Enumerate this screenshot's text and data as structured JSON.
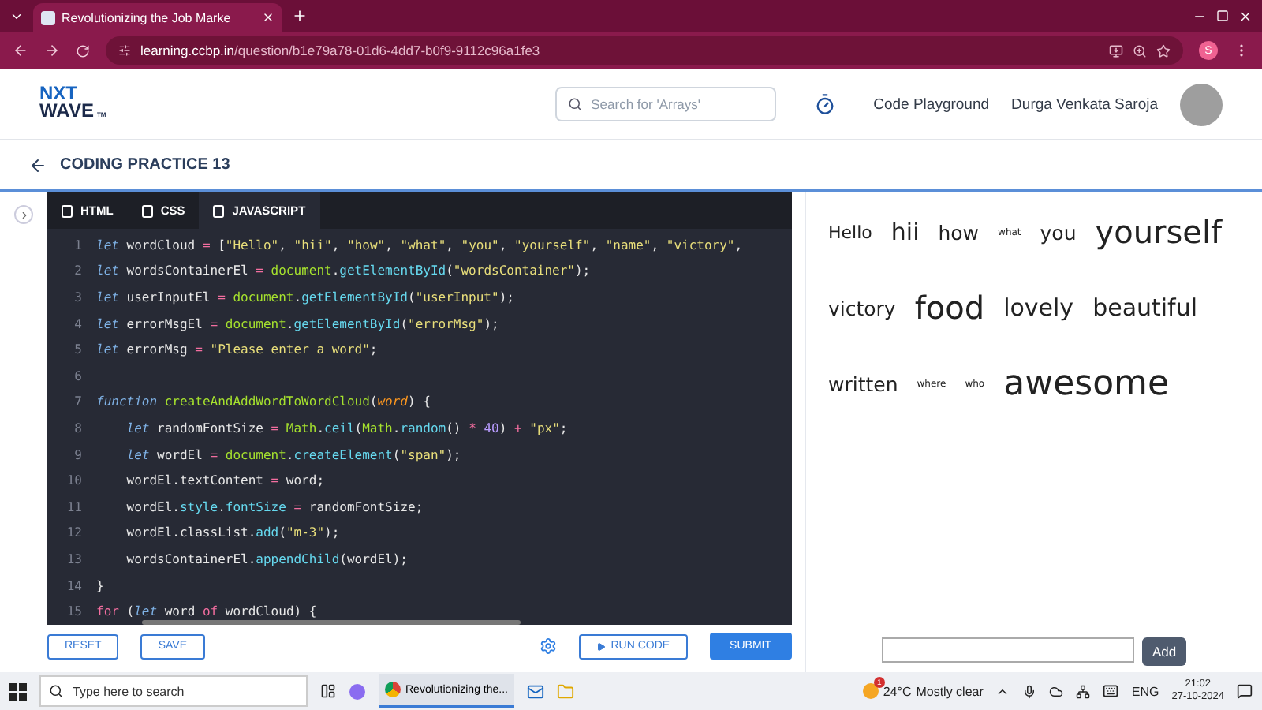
{
  "browser": {
    "tab_title": "Revolutionizing the Job Marke",
    "url_host": "learning.ccbp.in",
    "url_path": "/question/b1e79a78-01d6-4dd7-b0f9-9112c96a1fe3",
    "profile_initial": "S"
  },
  "header": {
    "logo_top": "NXT",
    "logo_bottom": "WAVE",
    "logo_mark": "TM",
    "search": {
      "placeholder": "Search for 'Arrays'"
    },
    "link": "Code Playground",
    "user_name": "Durga Venkata Saroja"
  },
  "page_title": "CODING PRACTICE 13",
  "editor_tabs": [
    {
      "label": "HTML",
      "selected": false
    },
    {
      "label": "CSS",
      "selected": false
    },
    {
      "label": "JAVASCRIPT",
      "selected": true
    }
  ],
  "code_lines": [
    {
      "number": "1",
      "tokens": [
        {
          "kind": "kw",
          "text": "let"
        },
        {
          "kind": "plain",
          "text": " wordCloud"
        },
        {
          "kind": "op",
          "text": " = "
        },
        {
          "kind": "plain",
          "text": "["
        },
        {
          "kind": "str",
          "text": "\"Hello\""
        },
        {
          "kind": "plain",
          "text": ", "
        },
        {
          "kind": "str",
          "text": "\"hii\""
        },
        {
          "kind": "plain",
          "text": ", "
        },
        {
          "kind": "str",
          "text": "\"how\""
        },
        {
          "kind": "plain",
          "text": ", "
        },
        {
          "kind": "str",
          "text": "\"what\""
        },
        {
          "kind": "plain",
          "text": ", "
        },
        {
          "kind": "str",
          "text": "\"you\""
        },
        {
          "kind": "plain",
          "text": ", "
        },
        {
          "kind": "str",
          "text": "\"yourself\""
        },
        {
          "kind": "plain",
          "text": ", "
        },
        {
          "kind": "str",
          "text": "\"name\""
        },
        {
          "kind": "plain",
          "text": ", "
        },
        {
          "kind": "str",
          "text": "\"victory\""
        },
        {
          "kind": "plain",
          "text": ","
        }
      ]
    },
    {
      "number": "2",
      "tokens": [
        {
          "kind": "kw",
          "text": "let"
        },
        {
          "kind": "plain",
          "text": " wordsContainerEl"
        },
        {
          "kind": "op",
          "text": " = "
        },
        {
          "kind": "obj",
          "text": "document"
        },
        {
          "kind": "plain",
          "text": "."
        },
        {
          "kind": "fn",
          "text": "getElementById"
        },
        {
          "kind": "plain",
          "text": "("
        },
        {
          "kind": "str",
          "text": "\"wordsContainer\""
        },
        {
          "kind": "plain",
          "text": ");"
        }
      ]
    },
    {
      "number": "3",
      "tokens": [
        {
          "kind": "kw",
          "text": "let"
        },
        {
          "kind": "plain",
          "text": " userInputEl"
        },
        {
          "kind": "op",
          "text": " = "
        },
        {
          "kind": "obj",
          "text": "document"
        },
        {
          "kind": "plain",
          "text": "."
        },
        {
          "kind": "fn",
          "text": "getElementById"
        },
        {
          "kind": "plain",
          "text": "("
        },
        {
          "kind": "str",
          "text": "\"userInput\""
        },
        {
          "kind": "plain",
          "text": ");"
        }
      ]
    },
    {
      "number": "4",
      "tokens": [
        {
          "kind": "kw",
          "text": "let"
        },
        {
          "kind": "plain",
          "text": " errorMsgEl"
        },
        {
          "kind": "op",
          "text": " = "
        },
        {
          "kind": "obj",
          "text": "document"
        },
        {
          "kind": "plain",
          "text": "."
        },
        {
          "kind": "fn",
          "text": "getElementById"
        },
        {
          "kind": "plain",
          "text": "("
        },
        {
          "kind": "str",
          "text": "\"errorMsg\""
        },
        {
          "kind": "plain",
          "text": ");"
        }
      ]
    },
    {
      "number": "5",
      "tokens": [
        {
          "kind": "kw",
          "text": "let"
        },
        {
          "kind": "plain",
          "text": " errorMsg"
        },
        {
          "kind": "op",
          "text": " = "
        },
        {
          "kind": "str",
          "text": "\"Please enter a word\""
        },
        {
          "kind": "plain",
          "text": ";"
        }
      ]
    },
    {
      "number": "6"
    },
    {
      "number": "7",
      "tokens": [
        {
          "kind": "kw",
          "text": "function "
        },
        {
          "kind": "obj",
          "text": "createAndAddWordToWordCloud"
        },
        {
          "kind": "plain",
          "text": "("
        },
        {
          "kind": "param",
          "text": "word"
        },
        {
          "kind": "plain",
          "text": ") {"
        }
      ]
    },
    {
      "number": "8",
      "tokens": [
        {
          "kind": "kw",
          "text": "    let"
        },
        {
          "kind": "plain",
          "text": " randomFontSize"
        },
        {
          "kind": "op",
          "text": " = "
        },
        {
          "kind": "obj",
          "text": "Math"
        },
        {
          "kind": "plain",
          "text": "."
        },
        {
          "kind": "fn",
          "text": "ceil"
        },
        {
          "kind": "plain",
          "text": "("
        },
        {
          "kind": "obj",
          "text": "Math"
        },
        {
          "kind": "plain",
          "text": "."
        },
        {
          "kind": "fn",
          "text": "random"
        },
        {
          "kind": "plain",
          "text": "()"
        },
        {
          "kind": "op",
          "text": " * "
        },
        {
          "kind": "num",
          "text": "40"
        },
        {
          "kind": "plain",
          "text": ")"
        },
        {
          "kind": "op",
          "text": " + "
        },
        {
          "kind": "str",
          "text": "\"px\""
        },
        {
          "kind": "plain",
          "text": ";"
        }
      ]
    },
    {
      "number": "9",
      "tokens": [
        {
          "kind": "kw",
          "text": "    let"
        },
        {
          "kind": "plain",
          "text": " wordEl"
        },
        {
          "kind": "op",
          "text": " = "
        },
        {
          "kind": "obj",
          "text": "document"
        },
        {
          "kind": "plain",
          "text": "."
        },
        {
          "kind": "fn",
          "text": "createElement"
        },
        {
          "kind": "plain",
          "text": "("
        },
        {
          "kind": "str",
          "text": "\"span\""
        },
        {
          "kind": "plain",
          "text": ");"
        }
      ]
    },
    {
      "number": "10",
      "tokens": [
        {
          "kind": "plain",
          "text": "    wordEl.textContent"
        },
        {
          "kind": "op",
          "text": " = "
        },
        {
          "kind": "plain",
          "text": "word;"
        }
      ]
    },
    {
      "number": "11",
      "tokens": [
        {
          "kind": "plain",
          "text": "    wordEl."
        },
        {
          "kind": "fn",
          "text": "style"
        },
        {
          "kind": "plain",
          "text": "."
        },
        {
          "kind": "fn",
          "text": "fontSize"
        },
        {
          "kind": "op",
          "text": " = "
        },
        {
          "kind": "plain",
          "text": "randomFontSize;"
        }
      ]
    },
    {
      "number": "12",
      "tokens": [
        {
          "kind": "plain",
          "text": "    wordEl.classList."
        },
        {
          "kind": "fn",
          "text": "add"
        },
        {
          "kind": "plain",
          "text": "("
        },
        {
          "kind": "str",
          "text": "\"m-3\""
        },
        {
          "kind": "plain",
          "text": ");"
        }
      ]
    },
    {
      "number": "13",
      "tokens": [
        {
          "kind": "plain",
          "text": "    wordsContainerEl."
        },
        {
          "kind": "fn",
          "text": "appendChild"
        },
        {
          "kind": "plain",
          "text": "(wordEl);"
        }
      ]
    },
    {
      "number": "14",
      "tokens": [
        {
          "kind": "plain",
          "text": "}"
        }
      ]
    },
    {
      "number": "15",
      "tokens": [
        {
          "kind": "op",
          "text": "for"
        },
        {
          "kind": "plain",
          "text": " ("
        },
        {
          "kind": "kw",
          "text": "let"
        },
        {
          "kind": "plain",
          "text": " word"
        },
        {
          "kind": "op",
          "text": " of "
        },
        {
          "kind": "plain",
          "text": "wordCloud) {"
        }
      ]
    }
  ],
  "editor_buttons": {
    "reset": "RESET",
    "save": "SAVE",
    "run": "RUN CODE",
    "submit": "SUBMIT"
  },
  "word_cloud": [
    [
      {
        "text": "Hello",
        "kind": "small"
      },
      {
        "text": "hii",
        "kind": "large"
      },
      {
        "text": "how",
        "kind": "medium"
      },
      {
        "text": "what",
        "kind": "tiny"
      },
      {
        "text": "you",
        "kind": "medium"
      },
      {
        "text": "yourself",
        "kind": "huge"
      }
    ],
    [
      {
        "text": "victory",
        "kind": "medium"
      },
      {
        "text": "food",
        "kind": "huge"
      },
      {
        "text": "lovely",
        "kind": "large"
      },
      {
        "text": "beautiful",
        "kind": "large"
      }
    ],
    [
      {
        "text": "written",
        "kind": "medium"
      },
      {
        "text": "where",
        "kind": "tiny"
      },
      {
        "text": "who",
        "kind": "tiny"
      },
      {
        "text": "awesome",
        "kind": "giant"
      }
    ]
  ],
  "add_button": "Add",
  "taskbar": {
    "search": {
      "placeholder": "Type here to search"
    },
    "app_title": "Revolutionizing the...",
    "weather_badge": "1",
    "temperature": "24°C",
    "weather": "Mostly clear",
    "language": "ENG",
    "time": "21:02",
    "date": "27-10-2024"
  }
}
